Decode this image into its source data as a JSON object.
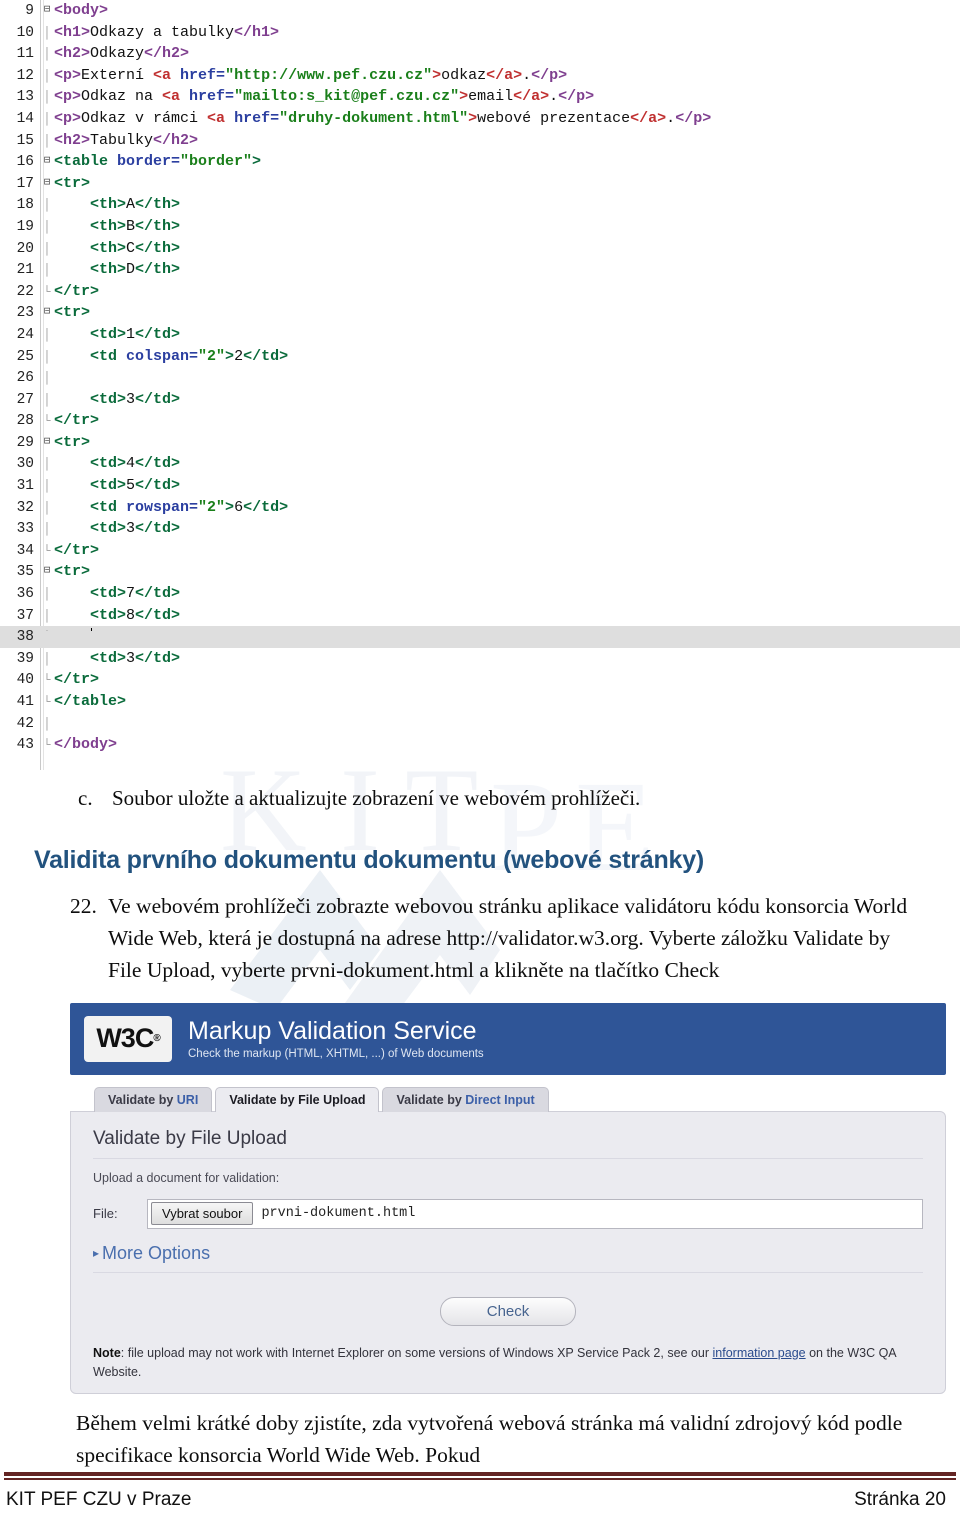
{
  "editor": {
    "lines": [
      {
        "no": "9",
        "fold": "minus",
        "bar": false,
        "segments": [
          {
            "t": "<body>",
            "c": "t-tag"
          }
        ]
      },
      {
        "no": "10",
        "fold": "none",
        "bar": true,
        "segments": [
          {
            "t": "<h1>",
            "c": "t-tag"
          },
          {
            "t": "Odkazy a tabulky",
            "c": "t-txt"
          },
          {
            "t": "</h1>",
            "c": "t-tag"
          }
        ]
      },
      {
        "no": "11",
        "fold": "none",
        "bar": true,
        "segments": [
          {
            "t": "<h2>",
            "c": "t-tag"
          },
          {
            "t": "Odkazy",
            "c": "t-txt"
          },
          {
            "t": "</h2>",
            "c": "t-tag"
          }
        ]
      },
      {
        "no": "12",
        "fold": "none",
        "bar": true,
        "segments": [
          {
            "t": "<p>",
            "c": "t-tag"
          },
          {
            "t": "Externí ",
            "c": "t-txt"
          },
          {
            "t": "<a ",
            "c": "t-lnk"
          },
          {
            "t": "href=",
            "c": "t-attr"
          },
          {
            "t": "\"http://www.pef.czu.cz\"",
            "c": "t-str"
          },
          {
            "t": ">",
            "c": "t-lnk"
          },
          {
            "t": "odkaz",
            "c": "t-txt"
          },
          {
            "t": "</a>",
            "c": "t-lnk"
          },
          {
            "t": ".",
            "c": "t-txt"
          },
          {
            "t": "</p>",
            "c": "t-tag"
          }
        ]
      },
      {
        "no": "13",
        "fold": "none",
        "bar": true,
        "segments": [
          {
            "t": "<p>",
            "c": "t-tag"
          },
          {
            "t": "Odkaz na ",
            "c": "t-txt"
          },
          {
            "t": "<a ",
            "c": "t-lnk"
          },
          {
            "t": "href=",
            "c": "t-attr"
          },
          {
            "t": "\"mailto:s_kit@pef.czu.cz\"",
            "c": "t-str"
          },
          {
            "t": ">",
            "c": "t-lnk"
          },
          {
            "t": "email",
            "c": "t-txt"
          },
          {
            "t": "</a>",
            "c": "t-lnk"
          },
          {
            "t": ".",
            "c": "t-txt"
          },
          {
            "t": "</p>",
            "c": "t-tag"
          }
        ]
      },
      {
        "no": "14",
        "fold": "none",
        "bar": true,
        "segments": [
          {
            "t": "<p>",
            "c": "t-tag"
          },
          {
            "t": "Odkaz v rámci ",
            "c": "t-txt"
          },
          {
            "t": "<a ",
            "c": "t-lnk"
          },
          {
            "t": "href=",
            "c": "t-attr"
          },
          {
            "t": "\"druhy-dokument.html\"",
            "c": "t-str"
          },
          {
            "t": ">",
            "c": "t-lnk"
          },
          {
            "t": "webové prezentace",
            "c": "t-txt"
          },
          {
            "t": "</a>",
            "c": "t-lnk"
          },
          {
            "t": ".",
            "c": "t-txt"
          },
          {
            "t": "</p>",
            "c": "t-tag"
          }
        ]
      },
      {
        "no": "15",
        "fold": "none",
        "bar": true,
        "segments": [
          {
            "t": "<h2>",
            "c": "t-tag"
          },
          {
            "t": "Tabulky",
            "c": "t-txt"
          },
          {
            "t": "</h2>",
            "c": "t-tag"
          }
        ]
      },
      {
        "no": "16",
        "fold": "minus",
        "bar": false,
        "segments": [
          {
            "t": "<table ",
            "c": "t-tag2"
          },
          {
            "t": "border=",
            "c": "t-attr"
          },
          {
            "t": "\"border\"",
            "c": "t-str"
          },
          {
            "t": ">",
            "c": "t-tag2"
          }
        ]
      },
      {
        "no": "17",
        "fold": "minus",
        "bar": false,
        "segments": [
          {
            "t": "<tr>",
            "c": "t-tag2"
          }
        ]
      },
      {
        "no": "18",
        "fold": "none",
        "bar": true,
        "segments": [
          {
            "t": "    <th>",
            "c": "t-tag2"
          },
          {
            "t": "A",
            "c": "t-txt"
          },
          {
            "t": "</th>",
            "c": "t-tag2"
          }
        ]
      },
      {
        "no": "19",
        "fold": "none",
        "bar": true,
        "segments": [
          {
            "t": "    <th>",
            "c": "t-tag2"
          },
          {
            "t": "B",
            "c": "t-txt"
          },
          {
            "t": "</th>",
            "c": "t-tag2"
          }
        ]
      },
      {
        "no": "20",
        "fold": "none",
        "bar": true,
        "segments": [
          {
            "t": "    <th>",
            "c": "t-tag2"
          },
          {
            "t": "C",
            "c": "t-txt"
          },
          {
            "t": "</th>",
            "c": "t-tag2"
          }
        ]
      },
      {
        "no": "21",
        "fold": "none",
        "bar": true,
        "segments": [
          {
            "t": "    <th>",
            "c": "t-tag2"
          },
          {
            "t": "D",
            "c": "t-txt"
          },
          {
            "t": "</th>",
            "c": "t-tag2"
          }
        ]
      },
      {
        "no": "22",
        "fold": "end",
        "bar": false,
        "segments": [
          {
            "t": "</tr>",
            "c": "t-tag2"
          }
        ]
      },
      {
        "no": "23",
        "fold": "minus",
        "bar": false,
        "segments": [
          {
            "t": "<tr>",
            "c": "t-tag2"
          }
        ]
      },
      {
        "no": "24",
        "fold": "none",
        "bar": true,
        "segments": [
          {
            "t": "    <td>",
            "c": "t-tag2"
          },
          {
            "t": "1",
            "c": "t-txt"
          },
          {
            "t": "</td>",
            "c": "t-tag2"
          }
        ]
      },
      {
        "no": "25",
        "fold": "none",
        "bar": true,
        "segments": [
          {
            "t": "    <td ",
            "c": "t-tag2"
          },
          {
            "t": "colspan=",
            "c": "t-attr"
          },
          {
            "t": "\"2\"",
            "c": "t-str"
          },
          {
            "t": ">",
            "c": "t-tag2"
          },
          {
            "t": "2",
            "c": "t-txt"
          },
          {
            "t": "</td>",
            "c": "t-tag2"
          }
        ]
      },
      {
        "no": "26",
        "fold": "none",
        "bar": true,
        "segments": []
      },
      {
        "no": "27",
        "fold": "none",
        "bar": true,
        "segments": [
          {
            "t": "    <td>",
            "c": "t-tag2"
          },
          {
            "t": "3",
            "c": "t-txt"
          },
          {
            "t": "</td>",
            "c": "t-tag2"
          }
        ]
      },
      {
        "no": "28",
        "fold": "end",
        "bar": false,
        "segments": [
          {
            "t": "</tr>",
            "c": "t-tag2"
          }
        ]
      },
      {
        "no": "29",
        "fold": "minus",
        "bar": false,
        "segments": [
          {
            "t": "<tr>",
            "c": "t-tag2"
          }
        ]
      },
      {
        "no": "30",
        "fold": "none",
        "bar": true,
        "segments": [
          {
            "t": "    <td>",
            "c": "t-tag2"
          },
          {
            "t": "4",
            "c": "t-txt"
          },
          {
            "t": "</td>",
            "c": "t-tag2"
          }
        ]
      },
      {
        "no": "31",
        "fold": "none",
        "bar": true,
        "segments": [
          {
            "t": "    <td>",
            "c": "t-tag2"
          },
          {
            "t": "5",
            "c": "t-txt"
          },
          {
            "t": "</td>",
            "c": "t-tag2"
          }
        ]
      },
      {
        "no": "32",
        "fold": "none",
        "bar": true,
        "segments": [
          {
            "t": "    <td ",
            "c": "t-tag2"
          },
          {
            "t": "rowspan=",
            "c": "t-attr"
          },
          {
            "t": "\"2\"",
            "c": "t-str"
          },
          {
            "t": ">",
            "c": "t-tag2"
          },
          {
            "t": "6",
            "c": "t-txt"
          },
          {
            "t": "</td>",
            "c": "t-tag2"
          }
        ]
      },
      {
        "no": "33",
        "fold": "none",
        "bar": true,
        "segments": [
          {
            "t": "    <td>",
            "c": "t-tag2"
          },
          {
            "t": "3",
            "c": "t-txt"
          },
          {
            "t": "</td>",
            "c": "t-tag2"
          }
        ]
      },
      {
        "no": "34",
        "fold": "end",
        "bar": false,
        "segments": [
          {
            "t": "</tr>",
            "c": "t-tag2"
          }
        ]
      },
      {
        "no": "35",
        "fold": "minus",
        "bar": false,
        "segments": [
          {
            "t": "<tr>",
            "c": "t-tag2"
          }
        ]
      },
      {
        "no": "36",
        "fold": "none",
        "bar": true,
        "segments": [
          {
            "t": "    <td>",
            "c": "t-tag2"
          },
          {
            "t": "7",
            "c": "t-txt"
          },
          {
            "t": "</td>",
            "c": "t-tag2"
          }
        ]
      },
      {
        "no": "37",
        "fold": "none",
        "bar": true,
        "segments": [
          {
            "t": "    <td>",
            "c": "t-tag2"
          },
          {
            "t": "8",
            "c": "t-txt"
          },
          {
            "t": "</td>",
            "c": "t-tag2"
          }
        ]
      },
      {
        "no": "38",
        "fold": "none",
        "bar": true,
        "highlight": true,
        "caret": true,
        "segments": [
          {
            "t": "    ",
            "c": "t-txt"
          }
        ]
      },
      {
        "no": "39",
        "fold": "none",
        "bar": true,
        "segments": [
          {
            "t": "    <td>",
            "c": "t-tag2"
          },
          {
            "t": "3",
            "c": "t-txt"
          },
          {
            "t": "</td>",
            "c": "t-tag2"
          }
        ]
      },
      {
        "no": "40",
        "fold": "end",
        "bar": false,
        "segments": [
          {
            "t": "</tr>",
            "c": "t-tag2"
          }
        ]
      },
      {
        "no": "41",
        "fold": "end",
        "bar": false,
        "segments": [
          {
            "t": "</table>",
            "c": "t-tag2"
          }
        ]
      },
      {
        "no": "42",
        "fold": "none",
        "bar": true,
        "segments": []
      },
      {
        "no": "43",
        "fold": "end",
        "bar": false,
        "segments": [
          {
            "t": "</body>",
            "c": "t-tag"
          }
        ]
      }
    ]
  },
  "doc": {
    "bullet_c_marker": "c.",
    "bullet_c_text": "Soubor uložte a aktualizujte zobrazení ve webovém prohlížeči.",
    "heading": "Validita prvního dokumentu dokumentu (webové stránky)",
    "item_marker": "22.",
    "item_text": "Ve webovém prohlížeči zobrazte webovou stránku aplikace validátoru kódu konsorcia World Wide Web, která je dostupná na adrese http://validator.w3.org. Vyberte záložku Validate by File Upload, vyberte prvni-dokument.html a klikněte na tlačítko Check",
    "tail_text": "Během velmi krátké doby zjistíte, zda vytvořená webová stránka má validní zdrojový kód podle specifikace konsorcia World Wide Web. Pokud"
  },
  "w3c": {
    "logo": "W3C",
    "logo_reg": "®",
    "title": "Markup Validation Service",
    "subtitle": "Check the markup (HTML, XHTML, ...) of Web documents",
    "tabs": [
      {
        "prefix": "Validate by ",
        "accent": "URI",
        "active": false
      },
      {
        "prefix": "Validate by ",
        "accent": "File Upload",
        "active": true
      },
      {
        "prefix": "Validate by ",
        "accent": "Direct Input",
        "active": false
      }
    ],
    "panel_heading": "Validate by File Upload",
    "panel_sub": "Upload a document for validation:",
    "file_label": "File:",
    "file_button": "Vybrat soubor",
    "file_name": "prvni-dokument.html",
    "more_options": "More Options",
    "more_options_arrow": "▸",
    "check_button": "Check",
    "note_bold": "Note",
    "note_part1": ": file upload may not work with Internet Explorer on some versions of Windows XP Service Pack 2, see our ",
    "note_link": "information page",
    "note_part2": " on the W3C QA Website."
  },
  "footer": {
    "left": "KIT PEF CZU v Praze",
    "right": "Stránka 20"
  },
  "colors": {
    "heading_blue": "#22527e",
    "w3c_header_blue": "#2f5597",
    "footer_rule": "#632423",
    "panel_bg": "#ebebf0"
  }
}
